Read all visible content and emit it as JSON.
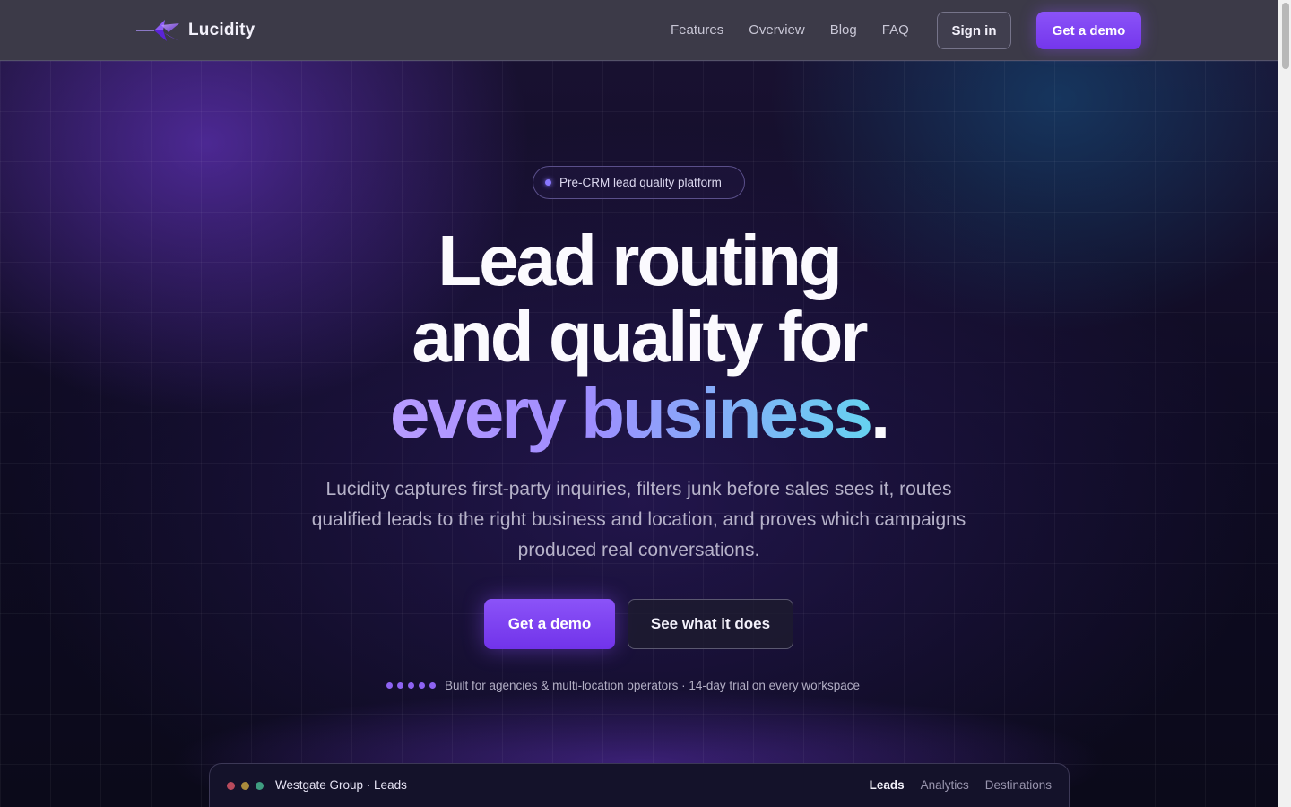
{
  "nav": {
    "brand": "Lucidity",
    "links": [
      "Features",
      "Overview",
      "Blog",
      "FAQ"
    ],
    "sign_in": "Sign in",
    "get_demo": "Get a demo"
  },
  "hero": {
    "badge": "Pre-CRM lead quality platform",
    "headline_line1": "Lead routing",
    "headline_line2": "and quality for",
    "headline_accent": "every business",
    "headline_period": ".",
    "subheadline": "Lucidity captures first-party inquiries, filters junk before sales sees it, routes qualified leads to the right business and location, and proves which campaigns produced real conversations.",
    "primary_cta": "Get a demo",
    "secondary_cta": "See what it does",
    "trust_text": "Built for agencies & multi-location operators · 14-day trial on every workspace"
  },
  "preview": {
    "title": "Westgate Group · Leads",
    "tabs": [
      "Leads",
      "Analytics",
      "Destinations"
    ],
    "active_tab": "Leads",
    "window_dot_colors": [
      "#e0566a",
      "#d9b44a",
      "#4fc7a0"
    ]
  },
  "colors": {
    "accent": "#7c3aed",
    "accent_light": "#8b53f8",
    "gradient_start": "#b89cff",
    "gradient_end": "#66d2f0"
  }
}
